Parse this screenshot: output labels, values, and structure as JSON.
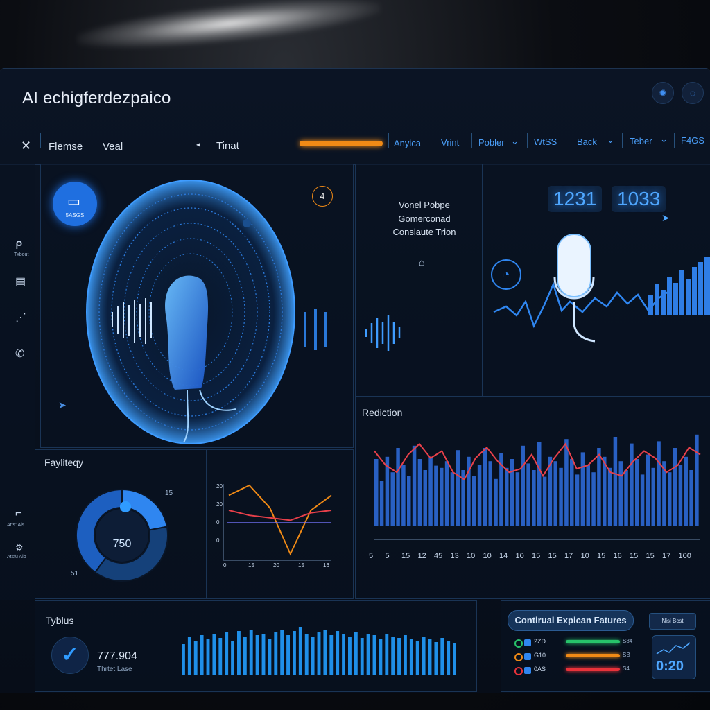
{
  "app_title": "AI echigferdezpaico",
  "nav": {
    "close_icon": "close-icon",
    "item1": "Flemse",
    "item2": "Veal",
    "item3": "Tinat",
    "links": [
      "Anyica",
      "Vrint",
      "Pobler",
      "WtSS",
      "Back",
      "Teber",
      "F4GS"
    ]
  },
  "sidebar": {
    "top_badge": "5ASGS",
    "icon_labels": [
      "Txbout",
      "",
      "",
      ""
    ],
    "bottom_labels": [
      "Atts: Als",
      "Atsfu Aio"
    ]
  },
  "voice_panel": {
    "badge_num": "4"
  },
  "info_panel": {
    "line1": "Vonel Pobpe",
    "line2": "Gomerconad",
    "line3": "Conslaute Trion"
  },
  "mic_panel": {
    "num1": "1231",
    "num2": "1033"
  },
  "reduction": {
    "title": "Rediction",
    "x_ticks": [
      "5",
      "5",
      "15",
      "12",
      "45",
      "13",
      "10",
      "10",
      "14",
      "10",
      "15",
      "15",
      "17",
      "10",
      "15",
      "16",
      "15",
      "15",
      "17",
      "100"
    ]
  },
  "fayli": {
    "title": "Fayliteqy",
    "center_value": "750",
    "label_tr": "15",
    "label_bl": "51"
  },
  "line_chart": {
    "y_ticks": [
      "20",
      "20",
      "0",
      "0"
    ],
    "x_ticks": [
      "0",
      "15",
      "20",
      "15",
      "16"
    ]
  },
  "tyblus": {
    "title": "Tyblus",
    "value": "777.904",
    "sub": "Thrtet Lase"
  },
  "features": {
    "title": "Contirual Expican Fatures",
    "button": "Nisi Bcst",
    "rows": [
      {
        "code": "2ZD",
        "color": "#27c26a",
        "value": "S84"
      },
      {
        "code": "G10",
        "color": "#f08a16",
        "value": "SB"
      },
      {
        "code": "0AS",
        "color": "#e8323a",
        "value": "S4"
      }
    ],
    "timer": "0:20"
  },
  "chart_data": [
    {
      "type": "bar",
      "title": "Rediction",
      "series": [
        {
          "values": [
            60,
            40,
            62,
            48,
            70,
            55,
            45,
            72,
            60,
            50,
            62,
            54,
            52,
            58,
            48,
            68,
            50,
            62,
            45,
            55,
            70,
            58,
            42,
            65,
            52,
            60,
            48,
            72,
            56,
            50,
            75,
            44,
            62,
            58,
            52,
            78,
            60,
            46,
            66,
            55,
            48,
            70,
            62,
            52,
            80,
            58,
            50,
            74,
            60,
            46,
            64,
            52,
            76,
            58,
            48,
            70,
            55,
            62,
            50,
            82
          ]
        }
      ],
      "line": [
        42,
        34,
        30,
        40,
        46,
        38,
        42,
        30,
        26,
        38,
        44,
        36,
        30,
        32,
        40,
        28,
        38,
        46,
        32,
        34,
        40,
        30,
        28,
        36,
        42,
        38,
        30,
        34,
        44,
        40
      ]
    },
    {
      "type": "pie",
      "title": "Fayliteqy",
      "values": [
        22,
        38,
        40
      ],
      "center": "750"
    },
    {
      "type": "line",
      "x": [
        0,
        15,
        20,
        15,
        16
      ],
      "series": [
        {
          "values": [
            22,
            30,
            12,
            -25,
            10,
            22
          ]
        },
        {
          "values": [
            10,
            6,
            4,
            2,
            8,
            10
          ]
        }
      ]
    },
    {
      "type": "bar",
      "title": "Tyblus",
      "series": [
        {
          "values": [
            45,
            55,
            50,
            58,
            52,
            60,
            54,
            62,
            50,
            64,
            56,
            66,
            58,
            60,
            52,
            62,
            66,
            58,
            64,
            70,
            60,
            56,
            62,
            66,
            58,
            64,
            60,
            56,
            62,
            54,
            60,
            58,
            52,
            60,
            56,
            54,
            58,
            52,
            50,
            56,
            52,
            48,
            54,
            50,
            46
          ]
        }
      ]
    }
  ]
}
